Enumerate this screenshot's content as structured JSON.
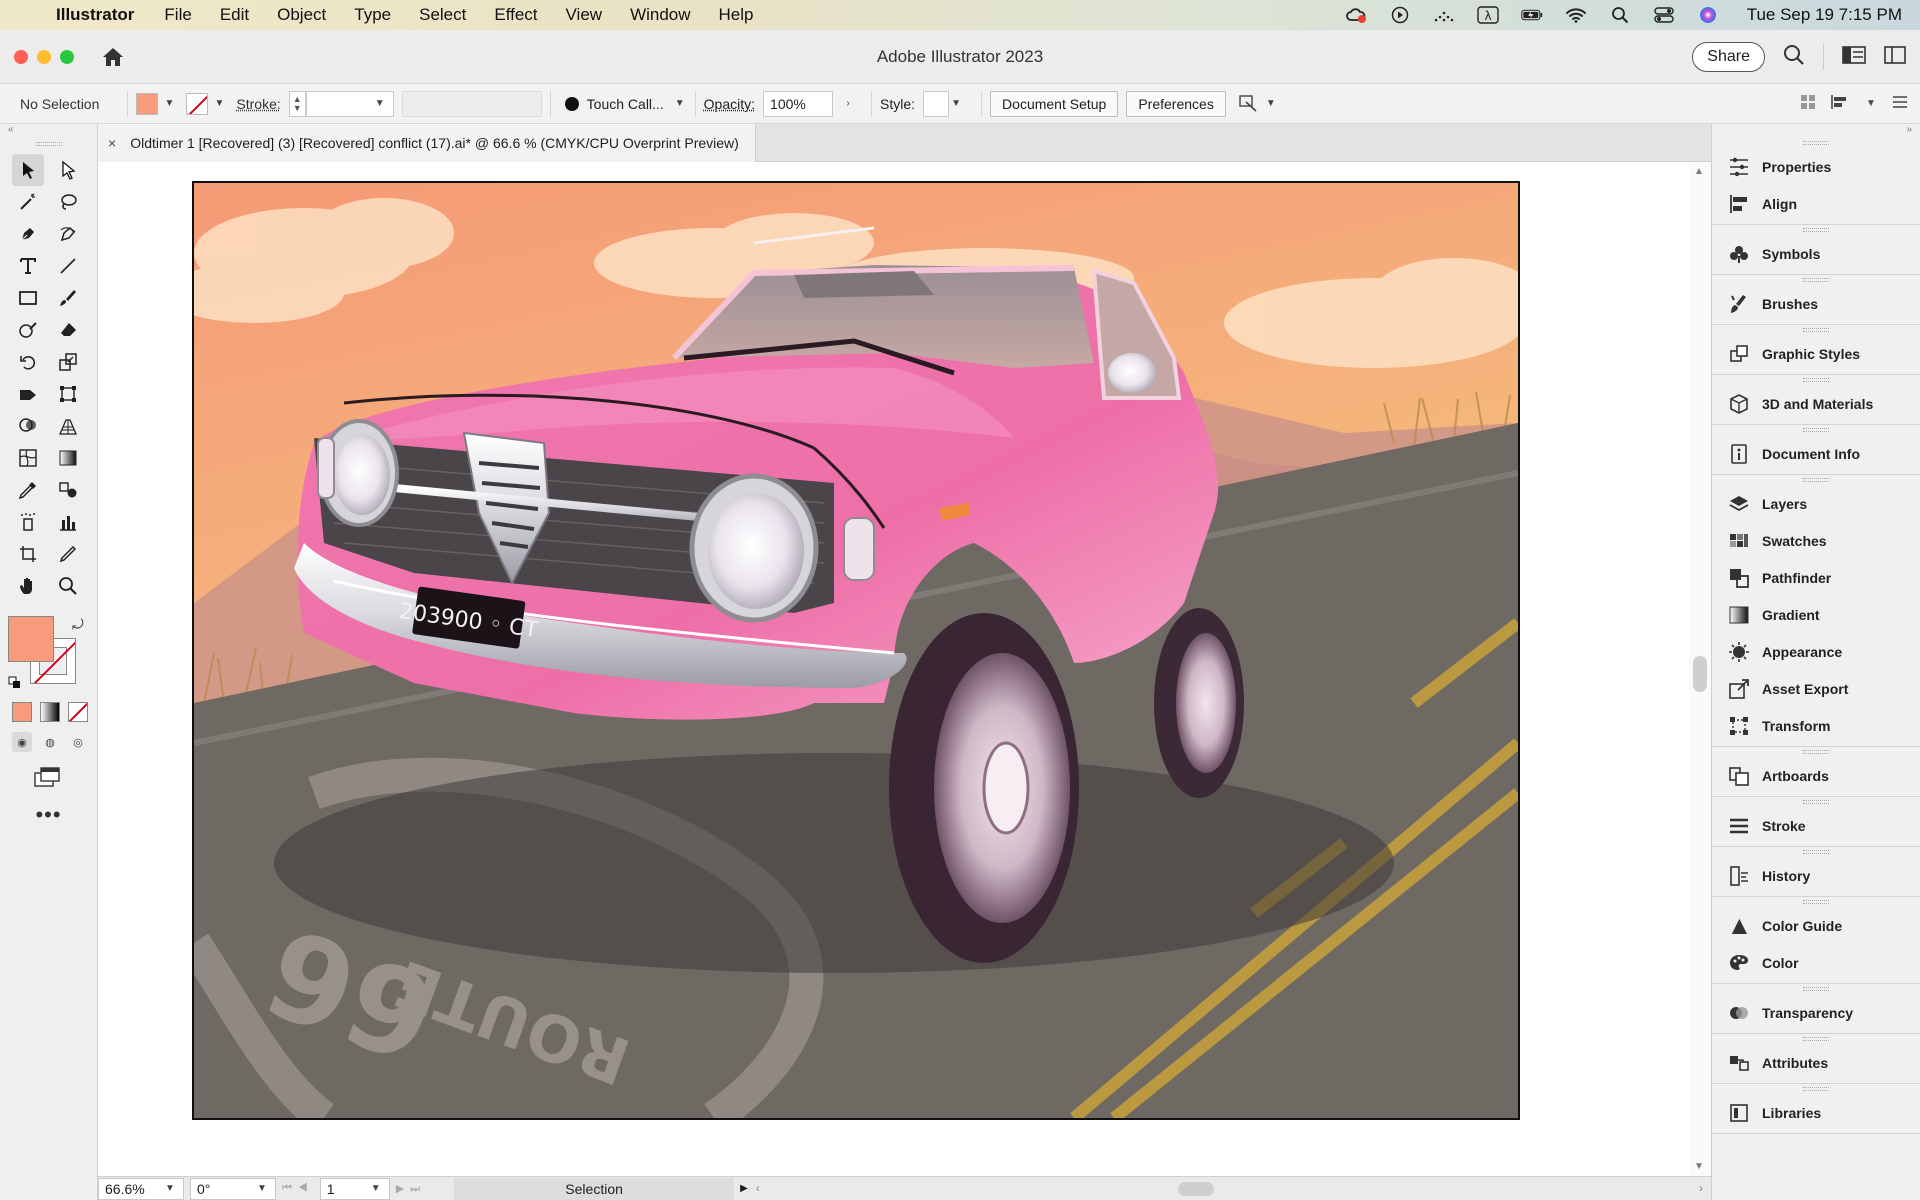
{
  "menubar": {
    "apple": "",
    "app_name": "Illustrator",
    "menus": [
      "File",
      "Edit",
      "Object",
      "Type",
      "Select",
      "Effect",
      "View",
      "Window",
      "Help"
    ],
    "status_icons": [
      "creative-cloud-icon",
      "play-circle-icon",
      "activity-icon",
      "lambda-icon",
      "battery-icon",
      "wifi-icon",
      "spotlight-search-icon",
      "control-center-icon",
      "siri-icon"
    ],
    "clock": "Tue Sep 19  7:15 PM"
  },
  "window": {
    "title": "Adobe Illustrator 2023",
    "share_label": "Share"
  },
  "controlbar": {
    "selection": "No Selection",
    "fill_color": "#f79b7c",
    "stroke_label": "Stroke:",
    "stroke_value": "",
    "brush": "Touch Call...",
    "opacity_label": "Opacity:",
    "opacity_value": "100%",
    "style_label": "Style:",
    "document_setup": "Document Setup",
    "preferences": "Preferences"
  },
  "document": {
    "tab_title": "Oldtimer 1 [Recovered] (3) [Recovered] conflict (17).ai* @ 66.6 % (CMYK/CPU Overprint Preview)",
    "close_label": "×"
  },
  "artwork": {
    "license_plate": "203900 ◦ CT",
    "road_sign": "ROUTE",
    "road_number": "66",
    "colors": {
      "car": "#f07ab0",
      "sky_top": "#f59a76",
      "sky_bottom": "#f3d96e",
      "road": "#6f6963",
      "road_line": "#c9a23b"
    }
  },
  "statusbar": {
    "zoom": "66.6%",
    "rotation": "0°",
    "artboard": "1",
    "current_tool": "Selection"
  },
  "panels": [
    {
      "items": [
        {
          "label": "Properties",
          "icon": "properties-icon"
        },
        {
          "label": "Align",
          "icon": "align-icon"
        }
      ]
    },
    {
      "items": [
        {
          "label": "Symbols",
          "icon": "symbols-icon"
        }
      ]
    },
    {
      "items": [
        {
          "label": "Brushes",
          "icon": "brushes-icon"
        }
      ]
    },
    {
      "items": [
        {
          "label": "Graphic Styles",
          "icon": "graphic-styles-icon"
        }
      ]
    },
    {
      "items": [
        {
          "label": "3D and Materials",
          "icon": "3d-materials-icon"
        }
      ]
    },
    {
      "items": [
        {
          "label": "Document Info",
          "icon": "document-info-icon"
        }
      ]
    },
    {
      "items": [
        {
          "label": "Layers",
          "icon": "layers-icon"
        },
        {
          "label": "Swatches",
          "icon": "swatches-icon"
        },
        {
          "label": "Pathfinder",
          "icon": "pathfinder-icon"
        },
        {
          "label": "Gradient",
          "icon": "gradient-icon"
        },
        {
          "label": "Appearance",
          "icon": "appearance-icon"
        },
        {
          "label": "Asset Export",
          "icon": "asset-export-icon"
        },
        {
          "label": "Transform",
          "icon": "transform-icon"
        }
      ]
    },
    {
      "items": [
        {
          "label": "Artboards",
          "icon": "artboards-icon"
        }
      ]
    },
    {
      "items": [
        {
          "label": "Stroke",
          "icon": "stroke-icon"
        }
      ]
    },
    {
      "items": [
        {
          "label": "History",
          "icon": "history-icon"
        }
      ]
    },
    {
      "items": [
        {
          "label": "Color Guide",
          "icon": "color-guide-icon"
        },
        {
          "label": "Color",
          "icon": "color-icon"
        }
      ]
    },
    {
      "items": [
        {
          "label": "Transparency",
          "icon": "transparency-icon"
        }
      ]
    },
    {
      "items": [
        {
          "label": "Attributes",
          "icon": "attributes-icon"
        }
      ]
    },
    {
      "items": [
        {
          "label": "Libraries",
          "icon": "libraries-icon"
        }
      ]
    }
  ]
}
